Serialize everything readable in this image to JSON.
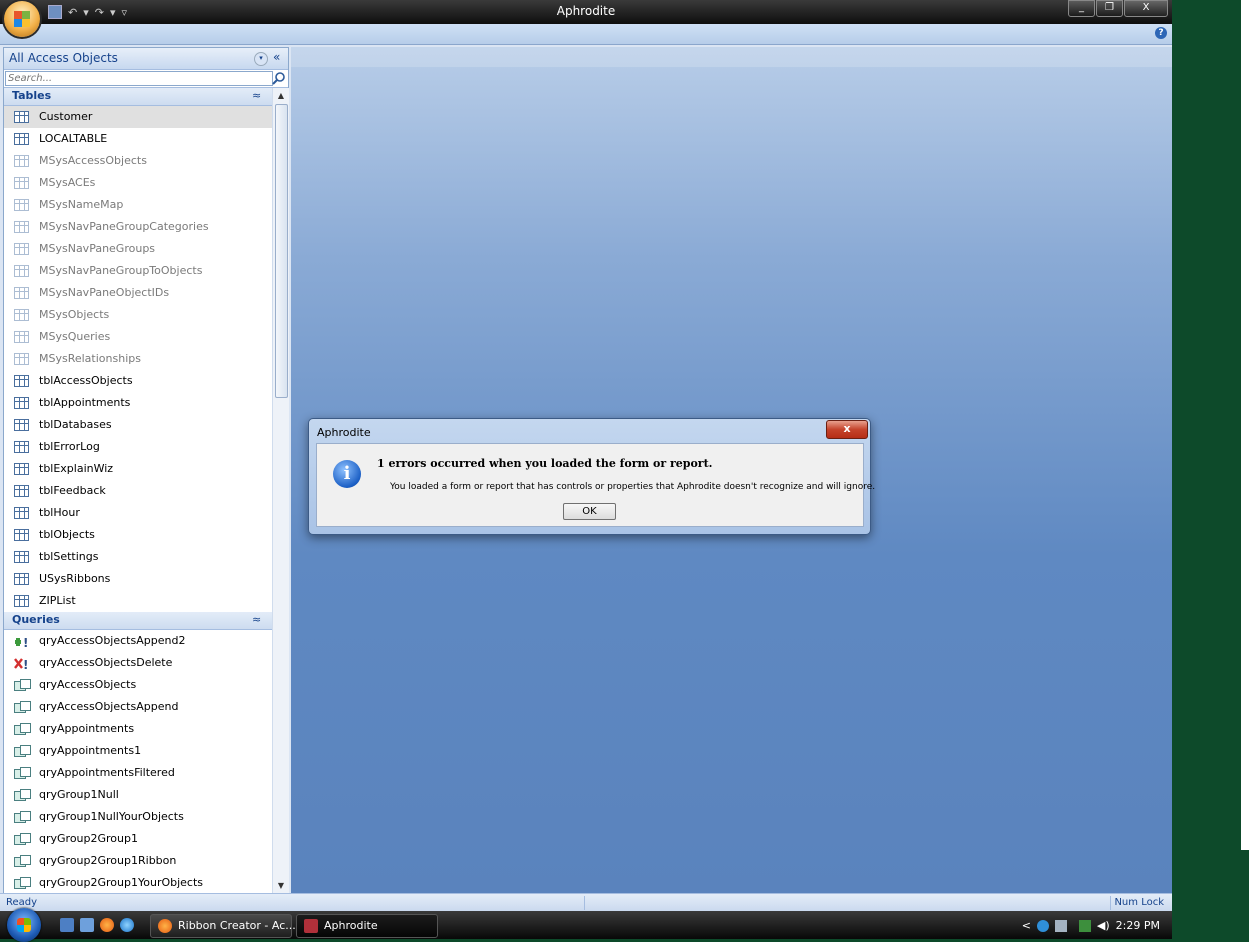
{
  "window": {
    "title": "Aphrodite",
    "minimize": "_",
    "maximize": "❐",
    "close": "X"
  },
  "nav": {
    "header": "All Access Objects",
    "collapse": "«",
    "dropdown": "▾",
    "search_placeholder": "Search...",
    "groups": {
      "tables": {
        "label": "Tables",
        "chevron": "≈",
        "items": [
          {
            "label": "Customer",
            "system": false,
            "selected": true
          },
          {
            "label": "LOCALTABLE",
            "system": false
          },
          {
            "label": "MSysAccessObjects",
            "system": true
          },
          {
            "label": "MSysACEs",
            "system": true
          },
          {
            "label": "MSysNameMap",
            "system": true
          },
          {
            "label": "MSysNavPaneGroupCategories",
            "system": true
          },
          {
            "label": "MSysNavPaneGroups",
            "system": true
          },
          {
            "label": "MSysNavPaneGroupToObjects",
            "system": true
          },
          {
            "label": "MSysNavPaneObjectIDs",
            "system": true
          },
          {
            "label": "MSysObjects",
            "system": true
          },
          {
            "label": "MSysQueries",
            "system": true
          },
          {
            "label": "MSysRelationships",
            "system": true
          },
          {
            "label": "tblAccessObjects",
            "system": false
          },
          {
            "label": "tblAppointments",
            "system": false
          },
          {
            "label": "tblDatabases",
            "system": false
          },
          {
            "label": "tblErrorLog",
            "system": false
          },
          {
            "label": "tblExplainWiz",
            "system": false
          },
          {
            "label": "tblFeedback",
            "system": false
          },
          {
            "label": "tblHour",
            "system": false
          },
          {
            "label": "tblObjects",
            "system": false
          },
          {
            "label": "tblSettings",
            "system": false
          },
          {
            "label": "USysRibbons",
            "system": false
          },
          {
            "label": "ZIPList",
            "system": false
          }
        ]
      },
      "queries": {
        "label": "Queries",
        "chevron": "≈",
        "items": [
          {
            "label": "qryAccessObjectsAppend2",
            "icon": "append-query-icon"
          },
          {
            "label": "qryAccessObjectsDelete",
            "icon": "delete-query-icon"
          },
          {
            "label": "qryAccessObjects",
            "icon": "select-query-icon"
          },
          {
            "label": "qryAccessObjectsAppend",
            "icon": "select-query-icon"
          },
          {
            "label": "qryAppointments",
            "icon": "select-query-icon"
          },
          {
            "label": "qryAppointments1",
            "icon": "select-query-icon"
          },
          {
            "label": "qryAppointmentsFiltered",
            "icon": "select-query-icon"
          },
          {
            "label": "qryGroup1Null",
            "icon": "select-query-icon"
          },
          {
            "label": "qryGroup1NullYourObjects",
            "icon": "select-query-icon"
          },
          {
            "label": "qryGroup2Group1",
            "icon": "select-query-icon"
          },
          {
            "label": "qryGroup2Group1Ribbon",
            "icon": "select-query-icon"
          },
          {
            "label": "qryGroup2Group1YourObjects",
            "icon": "select-query-icon"
          }
        ]
      }
    }
  },
  "dialog": {
    "title": "Aphrodite",
    "close": "x",
    "heading": "1 errors occurred when you loaded the form or report.",
    "message": "You loaded a form or report that has controls or properties that Aphrodite doesn't recognize and will ignore.",
    "ok": "OK"
  },
  "status": {
    "left": "Ready",
    "right": "Num Lock"
  },
  "taskbar": {
    "tasks": [
      "Ribbon Creator - Ac...",
      "Aphrodite"
    ],
    "clock": "2:29 PM",
    "tray_arrow": "<"
  },
  "colors": {
    "desktop": "#0d4a2a",
    "accent": "#15428b",
    "workspace": "#6b93c9"
  }
}
